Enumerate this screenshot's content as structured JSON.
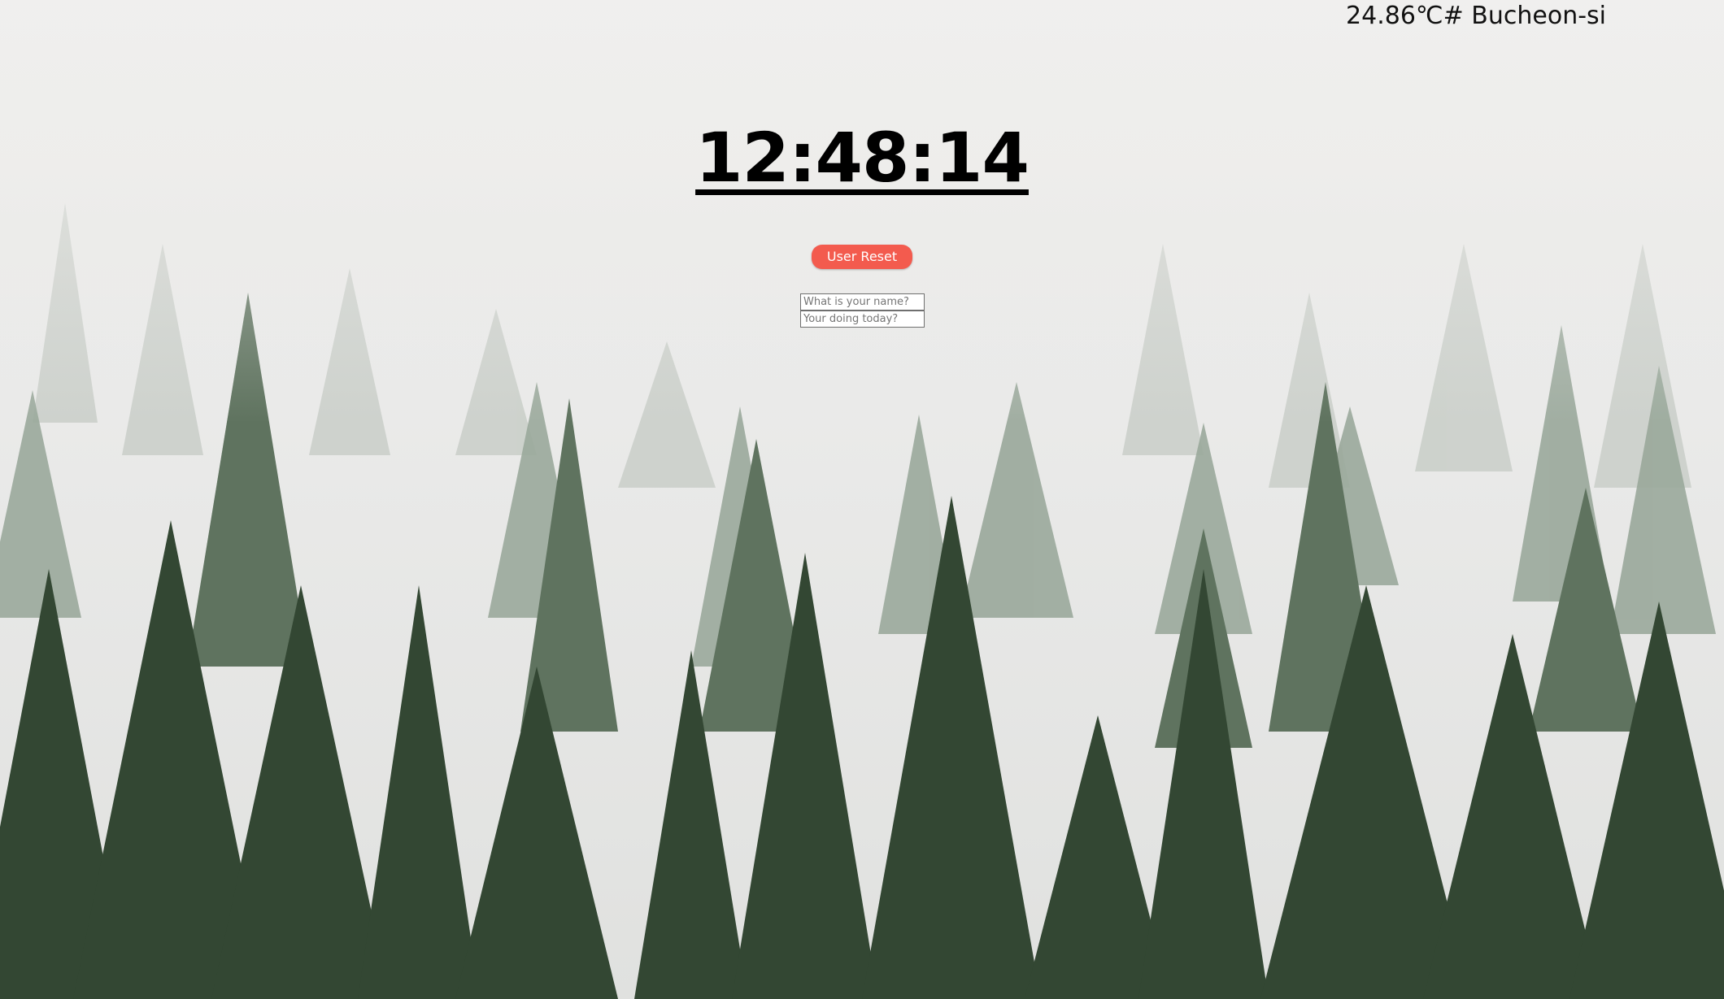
{
  "weather": {
    "text": "24.86℃# Bucheon-si"
  },
  "clock": {
    "time": "12:48:14"
  },
  "reset_button": {
    "label": "User Reset",
    "color": "#f35b4e"
  },
  "form": {
    "name_placeholder": "What is your name?",
    "name_value": "",
    "todo_placeholder": "Your doing today?",
    "todo_value": ""
  },
  "background": {
    "description_colors": [
      "#f3f1ef",
      "#dedfdc",
      "#7f8c7f",
      "#3a4b3b"
    ]
  }
}
